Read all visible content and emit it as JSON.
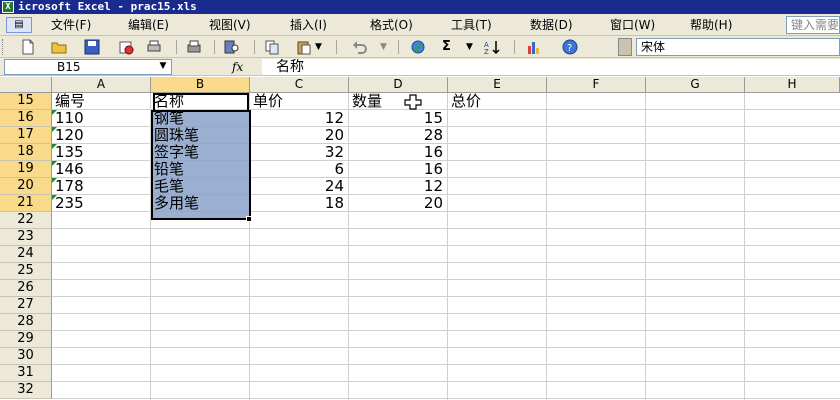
{
  "window": {
    "title": "icrosoft Excel - prac15.xls",
    "app_icon": "excel-icon"
  },
  "menu": {
    "items": [
      "文件(F)",
      "编辑(E)",
      "视图(V)",
      "插入(I)",
      "格式(O)",
      "工具(T)",
      "数据(D)",
      "窗口(W)",
      "帮助(H)"
    ],
    "help_placeholder": "键入需要"
  },
  "toolbar": {
    "icons": [
      "new-icon",
      "open-icon",
      "save-icon",
      "permission-icon",
      "print-icon",
      "print-preview-icon",
      "research-icon",
      "copy-icon",
      "paste-icon",
      "undo-icon",
      "hyperlink-icon",
      "autosum-icon",
      "sort-ascending-icon",
      "chart-icon",
      "help-icon"
    ],
    "sigma": "Σ",
    "font": "宋体"
  },
  "formula_bar": {
    "name_box": "B15",
    "fx": "fx",
    "content": "名称"
  },
  "columns": [
    "A",
    "B",
    "C",
    "D",
    "E",
    "F",
    "G",
    "H"
  ],
  "rows": [
    "15",
    "16",
    "17",
    "18",
    "19",
    "20",
    "21",
    "22",
    "23",
    "24",
    "25",
    "26",
    "27",
    "28",
    "29",
    "30",
    "31",
    "32"
  ],
  "selected_column": "B",
  "headers": {
    "id": "编号",
    "name": "名称",
    "price": "单价",
    "qty": "数量",
    "total": "总价"
  },
  "table": [
    {
      "id": "110",
      "name": "钢笔",
      "price": "12",
      "qty": "15"
    },
    {
      "id": "120",
      "name": "圆珠笔",
      "price": "20",
      "qty": "28"
    },
    {
      "id": "135",
      "name": "签字笔",
      "price": "32",
      "qty": "16"
    },
    {
      "id": "146",
      "name": "铅笔",
      "price": "6",
      "qty": "16"
    },
    {
      "id": "178",
      "name": "毛笔",
      "price": "24",
      "qty": "12"
    },
    {
      "id": "235",
      "name": "多用笔",
      "price": "18",
      "qty": "20"
    }
  ],
  "colors": {
    "title_bar": "#1a2b8f",
    "chrome": "#ece9d8",
    "selection": "#8aa2c8",
    "header_highlight": "#f9d98a",
    "number_indicator": "#1b8a3a"
  }
}
